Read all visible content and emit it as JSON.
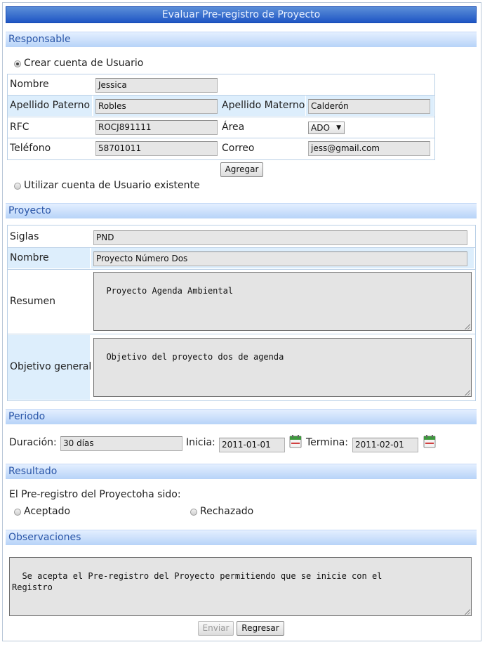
{
  "title": "Evaluar Pre-registro de Proyecto",
  "responsable": {
    "section_label": "Responsable",
    "radio_create": "Crear cuenta de Usuario",
    "radio_existing": "Utilizar cuenta de Usuario existente",
    "fields": {
      "nombre_label": "Nombre",
      "nombre_value": "Jessica",
      "apellido_paterno_label": "Apellido Paterno",
      "apellido_paterno_value": "Robles",
      "apellido_materno_label": "Apellido Materno",
      "apellido_materno_value": "Calderón",
      "rfc_label": "RFC",
      "rfc_value": "ROCJ891111",
      "area_label": "Área",
      "area_value": "ADO",
      "telefono_label": "Teléfono",
      "telefono_value": "58701011",
      "correo_label": "Correo",
      "correo_value": "jess@gmail.com"
    },
    "add_button": "Agregar"
  },
  "proyecto": {
    "section_label": "Proyecto",
    "siglas_label": "Siglas",
    "siglas_value": "PND",
    "nombre_label": "Nombre",
    "nombre_value": "Proyecto Número Dos",
    "resumen_label": "Resumen",
    "resumen_value": "Proyecto Agenda Ambiental",
    "objetivo_label": "Objetivo general",
    "objetivo_value": "Objetivo del proyecto dos de agenda"
  },
  "periodo": {
    "section_label": "Periodo",
    "duracion_label": "Duración:",
    "duracion_value": "30 días",
    "inicia_label": "Inicia:",
    "inicia_value": "2011-01-01",
    "termina_label": "Termina:",
    "termina_value": "2011-02-01"
  },
  "resultado": {
    "section_label": "Resultado",
    "prompt": "El Pre-registro del Proyectoha sido:",
    "aceptado": "Aceptado",
    "rechazado": "Rechazado"
  },
  "observaciones": {
    "section_label": "Observaciones",
    "value": "Se acepta el Pre-registro del Proyecto permitiendo que se inicie con el\nRegistro"
  },
  "buttons": {
    "enviar": "Enviar",
    "regresar": "Regresar"
  },
  "icons": {
    "calendar": "calendar-icon",
    "dropdown": "chevron-down-icon"
  }
}
